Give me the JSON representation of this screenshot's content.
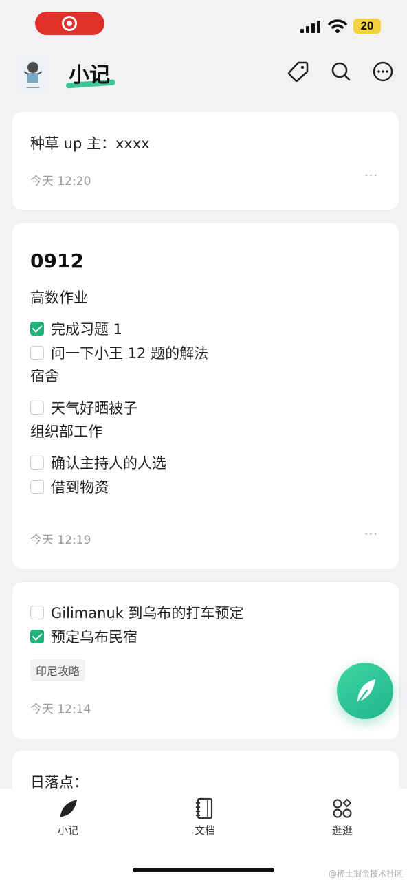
{
  "statusbar": {
    "battery": "20"
  },
  "header": {
    "title": "小记"
  },
  "cards": [
    {
      "text": "种草 up 主：xxxx",
      "time": "今天 12:20",
      "more": "···"
    },
    {
      "heading": "0912",
      "sections": [
        {
          "title": "高数作业",
          "items": [
            {
              "label": "完成习题 1",
              "checked": true
            },
            {
              "label": "问一下小王 12 题的解法",
              "checked": false
            }
          ]
        },
        {
          "title": "宿舍",
          "items": [
            {
              "label": "天气好晒被子",
              "checked": false
            }
          ]
        },
        {
          "title": "组织部工作",
          "items": [
            {
              "label": "确认主持人的人选",
              "checked": false
            },
            {
              "label": "借到物资",
              "checked": false
            }
          ]
        }
      ],
      "time": "今天 12:19",
      "more": "···"
    },
    {
      "items": [
        {
          "label": "Gilimanuk 到乌布的打车预定",
          "checked": false
        },
        {
          "label": "预定乌布民宿",
          "checked": true
        }
      ],
      "tag": "印尼攻略",
      "time": "今天 12:14"
    },
    {
      "text": "日落点："
    }
  ],
  "nav": [
    {
      "label": "小记",
      "icon": "feather-icon"
    },
    {
      "label": "文档",
      "icon": "notebook-icon"
    },
    {
      "label": "逛逛",
      "icon": "explore-icon"
    }
  ],
  "watermark": "@稀土掘金技术社区"
}
